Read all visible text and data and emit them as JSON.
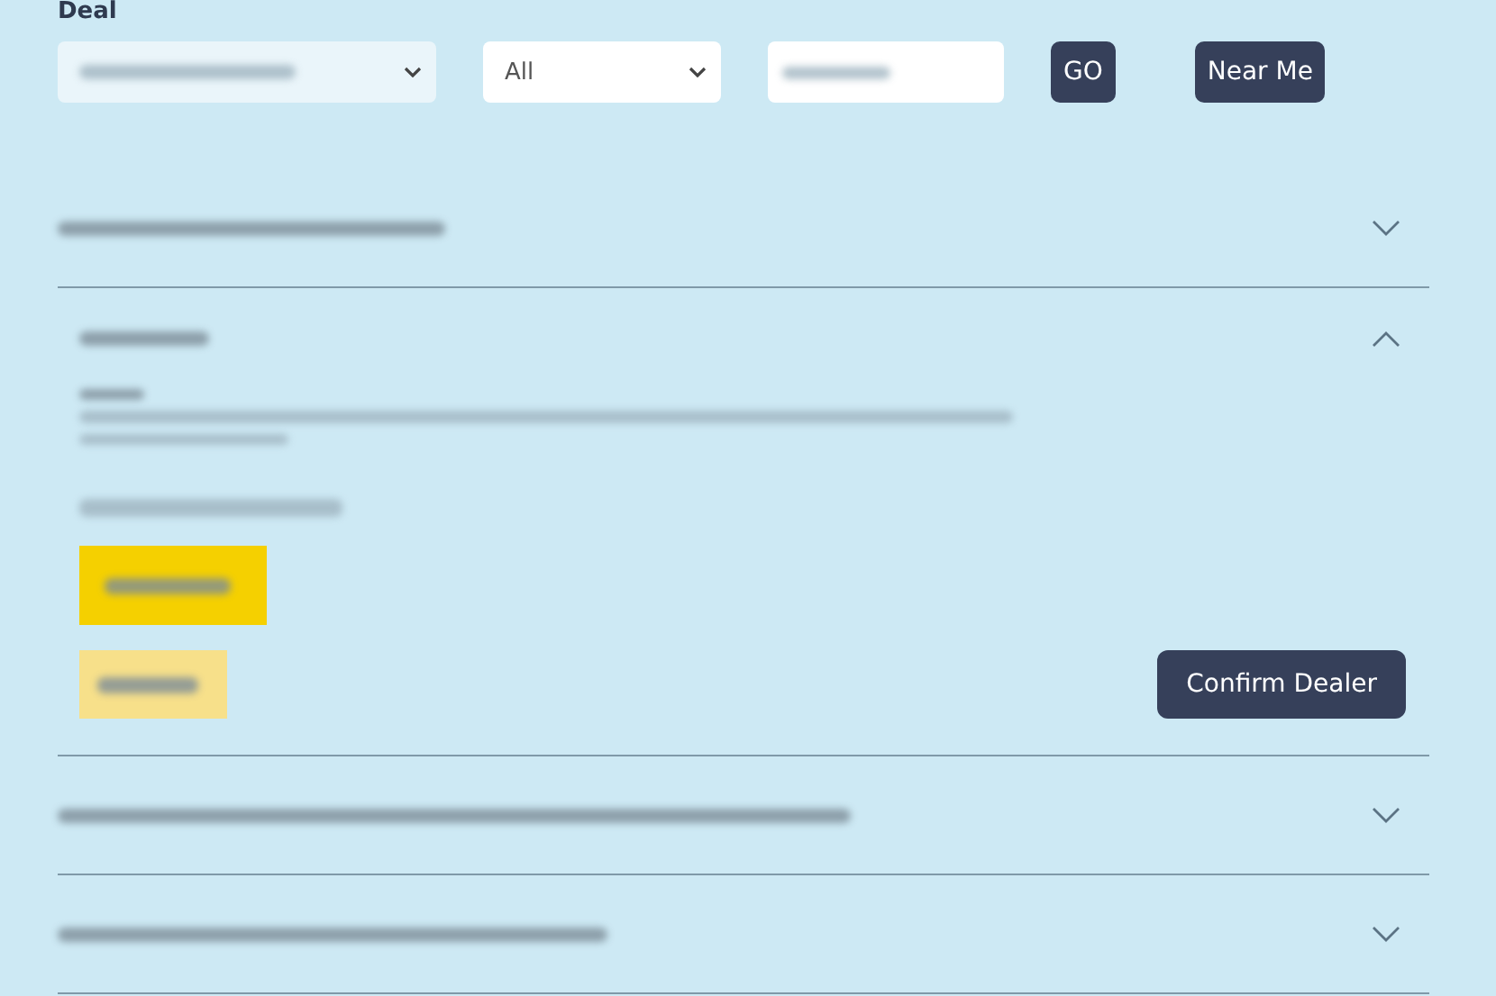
{
  "filter": {
    "label": "Deal",
    "type_select": {
      "value": "All"
    },
    "go_button": "GO",
    "near_me_button": "Near Me"
  },
  "dealers": [
    {
      "expanded": false
    },
    {
      "expanded": true,
      "confirm_button": "Confirm Dealer"
    },
    {
      "expanded": false
    },
    {
      "expanded": false
    }
  ]
}
